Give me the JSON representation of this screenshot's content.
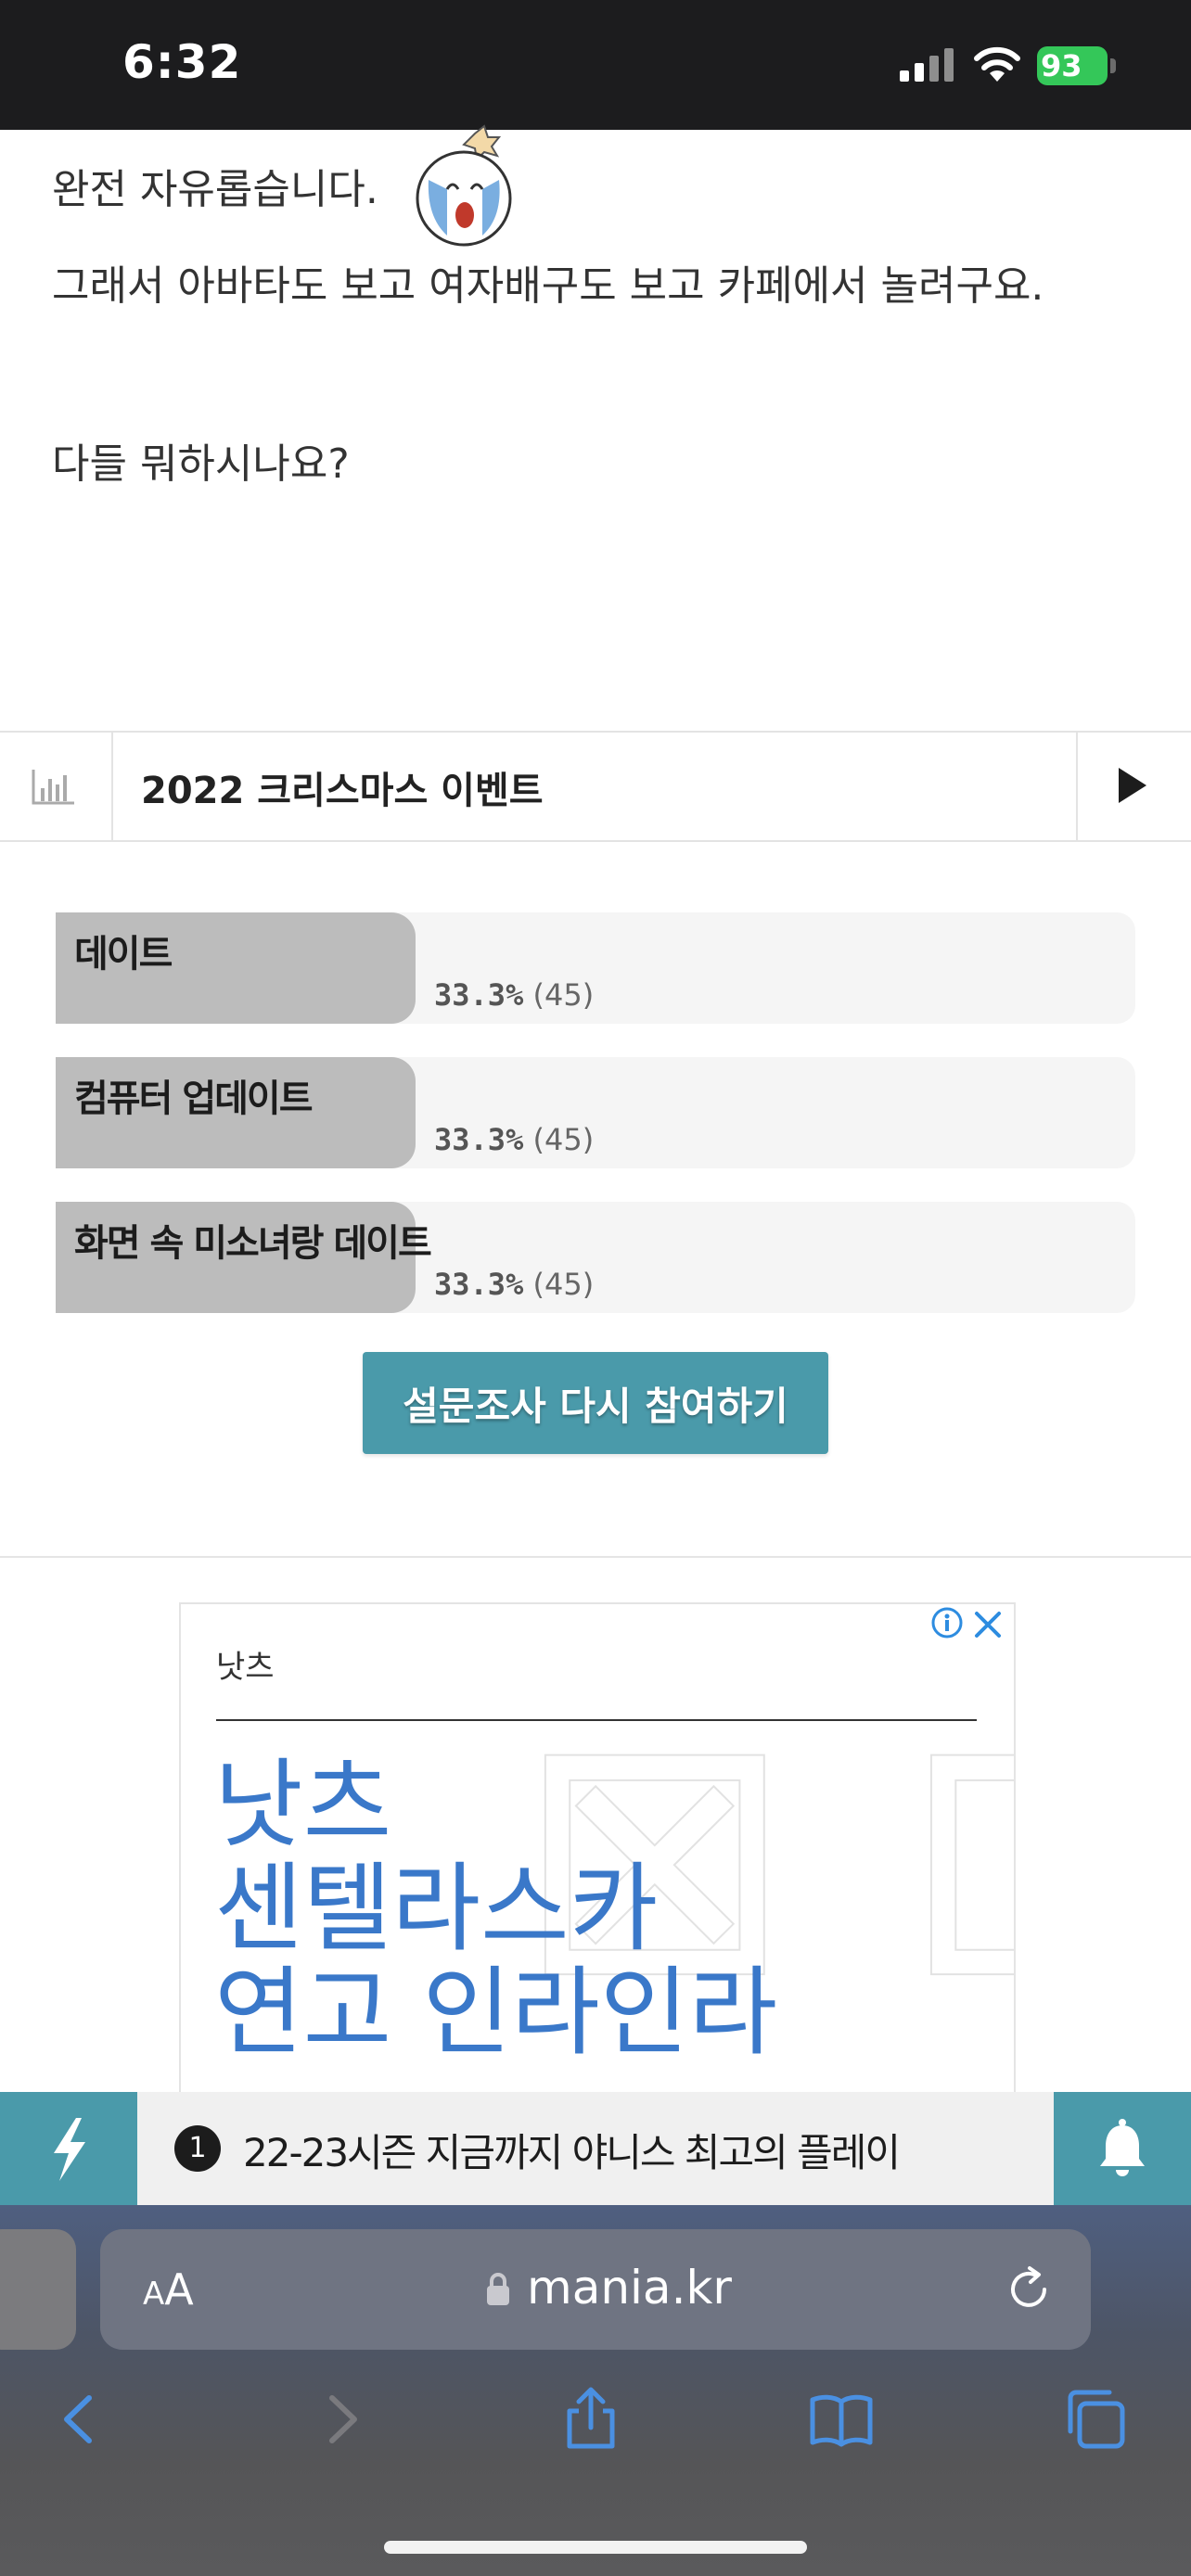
{
  "status_bar": {
    "time": "6:32",
    "battery": "93",
    "battery_color": "#34c759"
  },
  "post": {
    "line1": "완전 자유롭습니다.",
    "line2": "그래서 아바타도 보고 여자배구도 보고 카페에서 놀려구요.",
    "line3": "다들 뭐하시나요?"
  },
  "poll": {
    "title": "2022 크리스마스 이벤트",
    "options": [
      {
        "label": "데이트",
        "percent": "33.3%",
        "count": "(45)",
        "fraction": 0.333
      },
      {
        "label": "컴퓨터 업데이트",
        "percent": "33.3%",
        "count": "(45)",
        "fraction": 0.333
      },
      {
        "label": "화면 속 미소녀랑 데이트",
        "percent": "33.3%",
        "count": "(45)",
        "fraction": 0.333
      }
    ],
    "retry_label": "설문조사 다시 참여하기",
    "accent_color": "#4a9aaa"
  },
  "ad": {
    "brand": "낫츠",
    "headline": [
      "낫츠",
      "센텔라스카",
      "연고 인라인라"
    ],
    "headline_color": "#3a78c9"
  },
  "news_ticker": {
    "number": "1",
    "text": "22-23시즌 지금까지 야니스 최고의 플레이"
  },
  "browser": {
    "aa_small": "A",
    "aa_big": "A",
    "url": "mania.kr",
    "icons": [
      "back-icon",
      "forward-icon",
      "share-icon",
      "bookmarks-icon",
      "tabs-icon"
    ]
  }
}
